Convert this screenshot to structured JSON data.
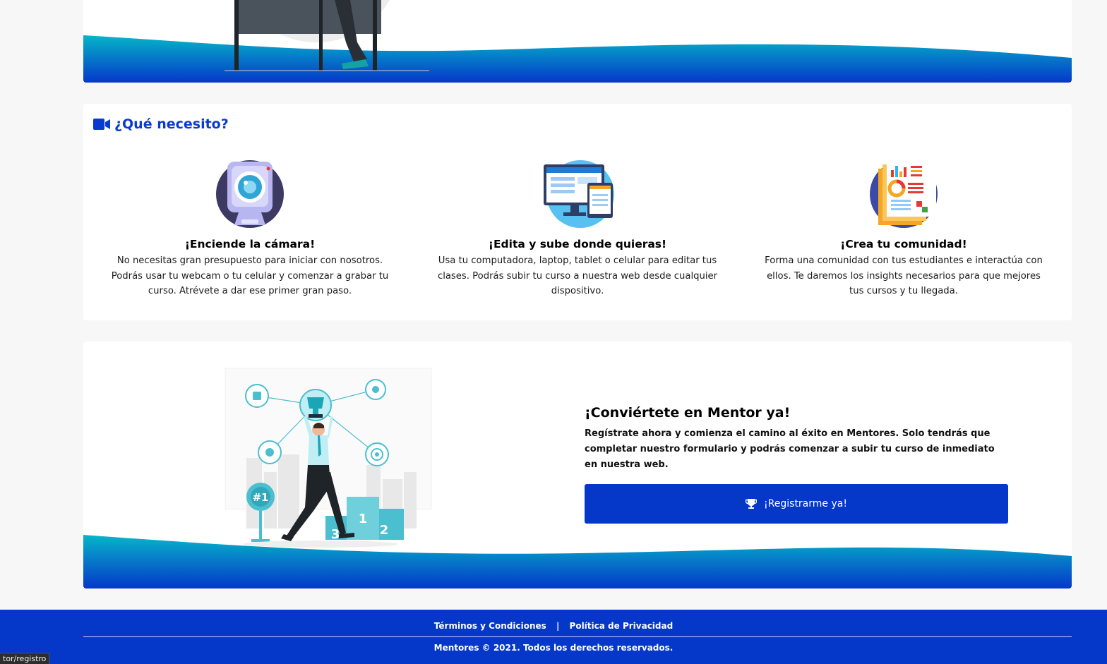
{
  "needs": {
    "title": "¿Qué necesito?",
    "title_icon": "video-camera-icon",
    "features": [
      {
        "icon": "webcam-illustration",
        "title": "¡Enciende la cámara!",
        "text": "No necesitas gran presupuesto para iniciar con nosotros. Podrás usar tu webcam o tu celular y comenzar a grabar tu curso. Atrévete a dar ese primer gran paso."
      },
      {
        "icon": "devices-illustration",
        "title": "¡Edita y sube donde quieras!",
        "text": "Usa tu computadora, laptop, tablet o celular para editar tus clases. Podrás subir tu curso a nuestra web desde cualquier dispositivo."
      },
      {
        "icon": "analytics-illustration",
        "title": "¡Crea tu comunidad!",
        "text": "Forma una comunidad con tus estudiantes e interactúa con ellos. Te daremos los insights necesarios para que mejores tus cursos y tu llegada."
      }
    ]
  },
  "cta": {
    "title": "¡Conviértete en Mentor ya!",
    "text": "Regístrate ahora y comienza el camino al éxito en Mentores. Solo tendrás que completar nuestro formulario y podrás comenzar a subir tu curso de inmediato en nuestra web.",
    "button_label": "¡Registrarme ya!",
    "button_icon": "trophy-icon",
    "podium_labels": [
      "1",
      "2",
      "3"
    ],
    "badge_label": "#1"
  },
  "footer": {
    "terms": "Términos y Condiciones",
    "separator": "|",
    "privacy": "Política de Privacidad",
    "copyright": "Mentores © 2021. Todos los derechos reservados."
  },
  "status_bar": {
    "url": "tor/registro"
  },
  "colors": {
    "primary": "#0537c9",
    "wave_top": "#06b6c8",
    "background": "#f7f7f7"
  }
}
